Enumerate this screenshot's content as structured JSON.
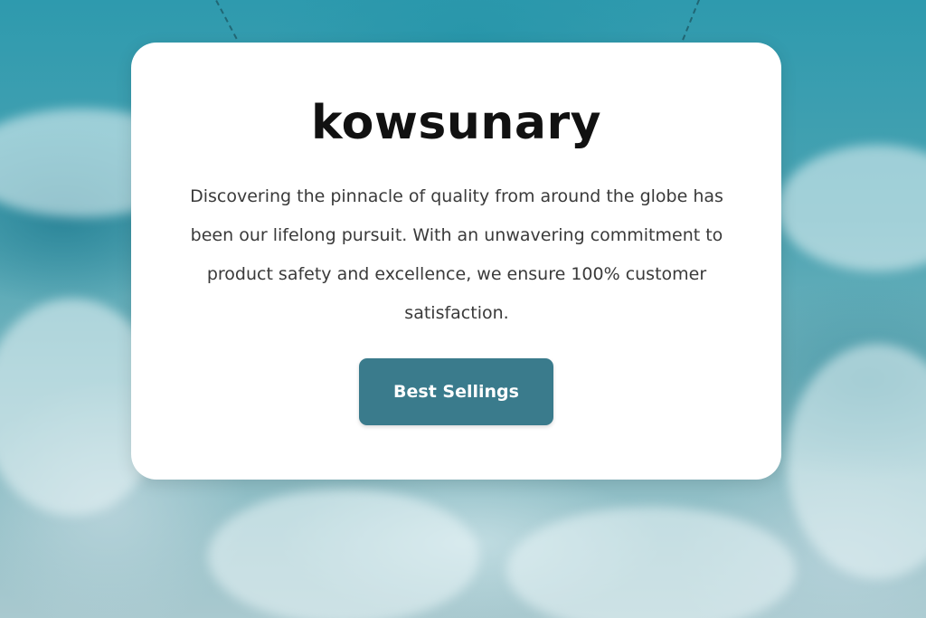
{
  "hero": {
    "brand_name": "kowsunary",
    "description": "Discovering the pinnacle of quality from around the globe has been our lifelong pursuit. With an unwavering commitment to product safety and excellence, we ensure 100% customer satisfaction.",
    "cta_label": "Best Sellings"
  },
  "colors": {
    "button_background": "#3a7b8c",
    "card_background": "#ffffff",
    "title_text": "#111111",
    "body_text": "#3a3a3a",
    "ocean_teal": "#2e9aae"
  },
  "icons": {
    "background_image": "ocean-waves-image"
  }
}
